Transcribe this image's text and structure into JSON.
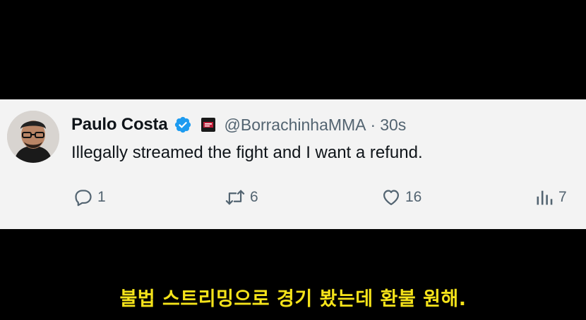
{
  "tweet": {
    "author": {
      "display_name": "Paulo Costa",
      "handle": "@BorrachinhaMMA"
    },
    "separator": "·",
    "time": "30s",
    "text": "Illegally streamed the fight and I want a refund.",
    "actions": {
      "reply_count": "1",
      "retweet_count": "6",
      "like_count": "16",
      "views_count": "7"
    }
  },
  "subtitle": "불법 스트리밍으로 경기 봤는데 환불 원해.",
  "colors": {
    "card_bg": "#f3f3f3",
    "verified_blue": "#1d9bf0",
    "muted_text": "#536471",
    "subtitle_yellow": "#f5e31a"
  }
}
